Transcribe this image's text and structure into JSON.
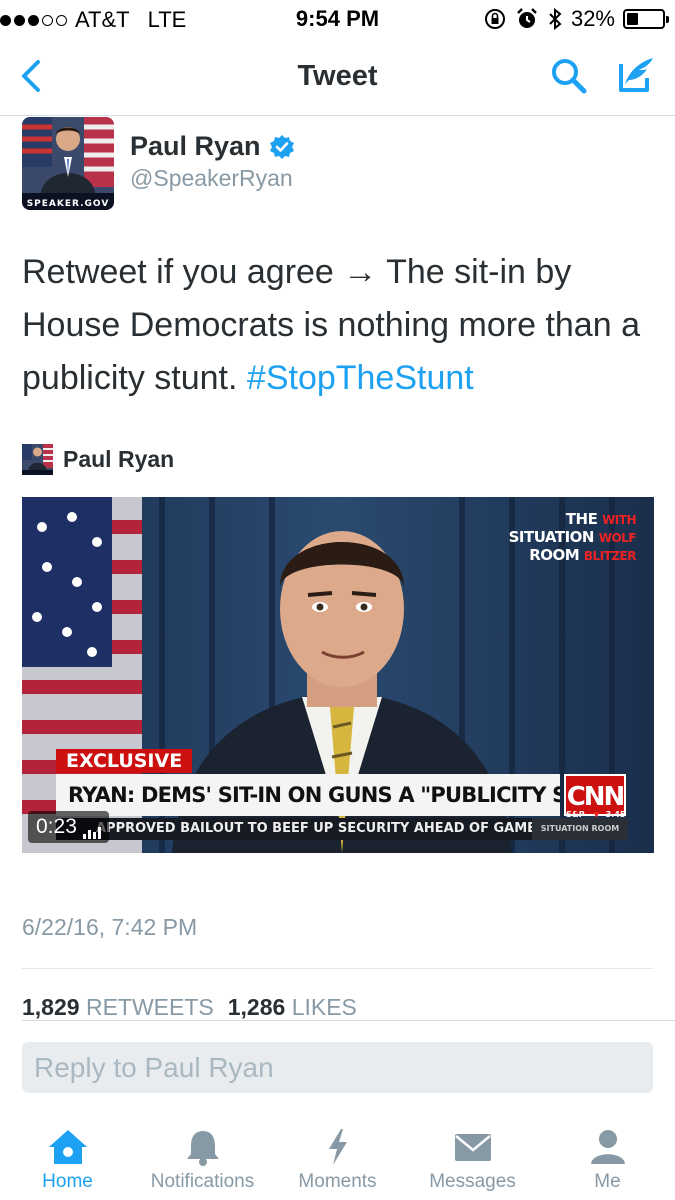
{
  "status_bar": {
    "carrier": "AT&T",
    "network": "LTE",
    "time": "9:54 PM",
    "battery_percent": "32%",
    "battery_level": 0.32,
    "signal_bars_filled": 3,
    "signal_bars_total": 5
  },
  "nav": {
    "title": "Tweet",
    "back_icon": "chevron-left-icon",
    "search_icon": "search-icon",
    "compose_icon": "compose-icon"
  },
  "tweet": {
    "author_name": "Paul Ryan",
    "author_handle": "@SpeakerRyan",
    "avatar_caption": "SPEAKER.GOV",
    "text_plain": "Retweet if you agree → The sit-in by House Democrats is nothing more than a publicity stunt.",
    "hashtag": "#StopTheStunt",
    "timestamp": "6/22/16, 7:42 PM",
    "retweets_count": "1,829",
    "retweets_label": "RETWEETS",
    "likes_count": "1,286",
    "likes_label": "LIKES"
  },
  "media": {
    "card_author": "Paul Ryan",
    "duration": "0:23",
    "show_line1": "THE",
    "show_with": "WITH",
    "show_line2": "SITUATION",
    "show_wolf": "WOLF",
    "show_line3": "ROOM",
    "show_blitzer": "BLITZER",
    "exclusive_label": "EXCLUSIVE",
    "headline": "RYAN: DEMS' SIT-IN ON GUNS A \"PUBLICITY STUNT\"",
    "network_logo": "CNN",
    "ticker": "APPROVED BAILOUT TO BEEF UP SECURITY AHEAD OF GAMES AND PA",
    "ticker_right": "SITUATION ROOM",
    "market": "S&P",
    "market_change": "-3.45"
  },
  "reply": {
    "placeholder": "Reply to Paul Ryan"
  },
  "tabs": [
    {
      "label": "Home",
      "icon": "home-icon",
      "active": true
    },
    {
      "label": "Notifications",
      "icon": "bell-icon",
      "active": false
    },
    {
      "label": "Moments",
      "icon": "lightning-icon",
      "active": false
    },
    {
      "label": "Messages",
      "icon": "envelope-icon",
      "active": false
    },
    {
      "label": "Me",
      "icon": "person-icon",
      "active": false
    }
  ],
  "colors": {
    "accent": "#1da1f2",
    "text": "#292f33",
    "muted": "#8899a6",
    "cnn_red": "#cc1010"
  }
}
